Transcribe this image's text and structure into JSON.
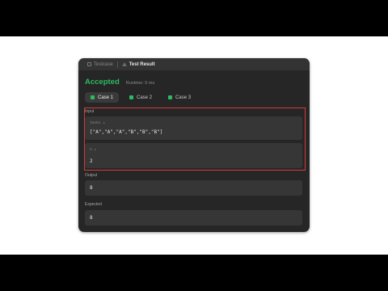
{
  "tabs": {
    "testcase": "Testcase",
    "result": "Test Result"
  },
  "status": "Accepted",
  "runtime": "Runtime: 0 ms",
  "cases": [
    {
      "label": "Case 1"
    },
    {
      "label": "Case 2"
    },
    {
      "label": "Case 3"
    }
  ],
  "input": {
    "label": "Input",
    "tasks_name": "tasks =",
    "tasks_value": "[\"A\",\"A\",\"A\",\"B\",\"B\",\"B\"]",
    "n_name": "n =",
    "n_value": "2"
  },
  "output": {
    "label": "Output",
    "value": "8"
  },
  "expected": {
    "label": "Expected",
    "value": "8"
  },
  "colors": {
    "accepted": "#2cbb5d",
    "highlight": "#d23b3b",
    "panel": "#262626"
  }
}
